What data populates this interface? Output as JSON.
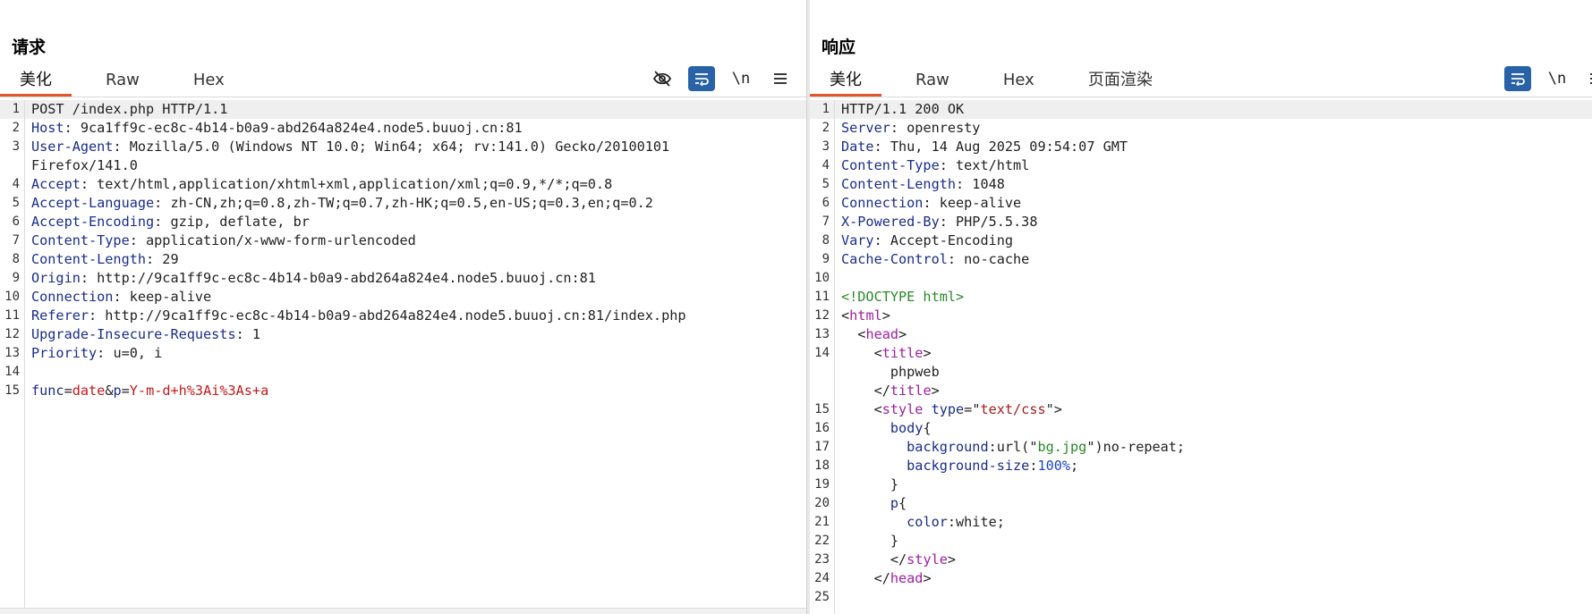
{
  "request": {
    "title": "请求",
    "tabs": [
      "美化",
      "Raw",
      "Hex"
    ],
    "active_tab": "美化",
    "toolbar": {
      "newline_label": "\\n"
    },
    "lines": [
      {
        "n": "1",
        "parts": [
          [
            "v",
            "POST /index.php HTTP/1.1"
          ]
        ]
      },
      {
        "n": "2",
        "parts": [
          [
            "k",
            "Host"
          ],
          [
            "v",
            ": 9ca1ff9c-ec8c-4b14-b0a9-abd264a824e4.node5.buuoj.cn:81"
          ]
        ]
      },
      {
        "n": "3",
        "parts": [
          [
            "k",
            "User-Agent"
          ],
          [
            "v",
            ": Mozilla/5.0 (Windows NT 10.0; Win64; x64; rv:141.0) Gecko/20100101"
          ]
        ]
      },
      {
        "n": "",
        "parts": [
          [
            "v",
            "Firefox/141.0"
          ]
        ]
      },
      {
        "n": "4",
        "parts": [
          [
            "k",
            "Accept"
          ],
          [
            "v",
            ": text/html,application/xhtml+xml,application/xml;q=0.9,*/*;q=0.8"
          ]
        ]
      },
      {
        "n": "5",
        "parts": [
          [
            "k",
            "Accept-Language"
          ],
          [
            "v",
            ": zh-CN,zh;q=0.8,zh-TW;q=0.7,zh-HK;q=0.5,en-US;q=0.3,en;q=0.2"
          ]
        ]
      },
      {
        "n": "6",
        "parts": [
          [
            "k",
            "Accept-Encoding"
          ],
          [
            "v",
            ": gzip, deflate, br"
          ]
        ]
      },
      {
        "n": "7",
        "parts": [
          [
            "k",
            "Content-Type"
          ],
          [
            "v",
            ": application/x-www-form-urlencoded"
          ]
        ]
      },
      {
        "n": "8",
        "parts": [
          [
            "k",
            "Content-Length"
          ],
          [
            "v",
            ": 29"
          ]
        ]
      },
      {
        "n": "9",
        "parts": [
          [
            "k",
            "Origin"
          ],
          [
            "v",
            ": http://9ca1ff9c-ec8c-4b14-b0a9-abd264a824e4.node5.buuoj.cn:81"
          ]
        ]
      },
      {
        "n": "10",
        "parts": [
          [
            "k",
            "Connection"
          ],
          [
            "v",
            ": keep-alive"
          ]
        ]
      },
      {
        "n": "11",
        "parts": [
          [
            "k",
            "Referer"
          ],
          [
            "v",
            ": http://9ca1ff9c-ec8c-4b14-b0a9-abd264a824e4.node5.buuoj.cn:81/index.php"
          ]
        ]
      },
      {
        "n": "12",
        "parts": [
          [
            "k",
            "Upgrade-Insecure-Requests"
          ],
          [
            "v",
            ": 1"
          ]
        ]
      },
      {
        "n": "13",
        "parts": [
          [
            "k",
            "Priority"
          ],
          [
            "v",
            ": u=0, i"
          ]
        ]
      },
      {
        "n": "14",
        "parts": [
          [
            "v",
            ""
          ]
        ]
      },
      {
        "n": "15",
        "parts": [
          [
            "pn",
            "func"
          ],
          [
            "v",
            "="
          ],
          [
            "pv",
            "date"
          ],
          [
            "v",
            "&"
          ],
          [
            "pn",
            "p"
          ],
          [
            "v",
            "="
          ],
          [
            "pv",
            "Y-m-d+h%3Ai%3As+a"
          ]
        ]
      }
    ]
  },
  "response": {
    "title": "响应",
    "tabs": [
      "美化",
      "Raw",
      "Hex",
      "页面渲染"
    ],
    "active_tab": "美化",
    "toolbar": {
      "newline_label": "\\n"
    },
    "lines": [
      {
        "n": "1",
        "parts": [
          [
            "v",
            "HTTP/1.1 200 OK"
          ]
        ]
      },
      {
        "n": "2",
        "parts": [
          [
            "k",
            "Server"
          ],
          [
            "v",
            ": openresty"
          ]
        ]
      },
      {
        "n": "3",
        "parts": [
          [
            "k",
            "Date"
          ],
          [
            "v",
            ": Thu, 14 Aug 2025 09:54:07 GMT"
          ]
        ]
      },
      {
        "n": "4",
        "parts": [
          [
            "k",
            "Content-Type"
          ],
          [
            "v",
            ": text/html"
          ]
        ]
      },
      {
        "n": "5",
        "parts": [
          [
            "k",
            "Content-Length"
          ],
          [
            "v",
            ": 1048"
          ]
        ]
      },
      {
        "n": "6",
        "parts": [
          [
            "k",
            "Connection"
          ],
          [
            "v",
            ": keep-alive"
          ]
        ]
      },
      {
        "n": "7",
        "parts": [
          [
            "k",
            "X-Powered-By"
          ],
          [
            "v",
            ": PHP/5.5.38"
          ]
        ]
      },
      {
        "n": "8",
        "parts": [
          [
            "k",
            "Vary"
          ],
          [
            "v",
            ": Accept-Encoding"
          ]
        ]
      },
      {
        "n": "9",
        "parts": [
          [
            "k",
            "Cache-Control"
          ],
          [
            "v",
            ": no-cache"
          ]
        ]
      },
      {
        "n": "10",
        "parts": [
          [
            "v",
            ""
          ]
        ]
      },
      {
        "n": "11",
        "parts": [
          [
            "doc",
            "<!DOCTYPE html>"
          ]
        ]
      },
      {
        "n": "12",
        "parts": [
          [
            "v",
            "<"
          ],
          [
            "tag",
            "html"
          ],
          [
            "v",
            ">"
          ]
        ]
      },
      {
        "n": "13",
        "parts": [
          [
            "v",
            "  <"
          ],
          [
            "tag",
            "head"
          ],
          [
            "v",
            ">"
          ]
        ]
      },
      {
        "n": "14",
        "parts": [
          [
            "v",
            "    <"
          ],
          [
            "tag",
            "title"
          ],
          [
            "v",
            ">"
          ]
        ]
      },
      {
        "n": "",
        "parts": [
          [
            "v",
            "      phpweb"
          ]
        ]
      },
      {
        "n": "",
        "parts": [
          [
            "v",
            "    </"
          ],
          [
            "tag",
            "title"
          ],
          [
            "v",
            ">"
          ]
        ]
      },
      {
        "n": "15",
        "parts": [
          [
            "v",
            "    <"
          ],
          [
            "tag",
            "style"
          ],
          [
            "v",
            " "
          ],
          [
            "k",
            "type"
          ],
          [
            "v",
            "=\""
          ],
          [
            "str",
            "text/css"
          ],
          [
            "v",
            "\">"
          ]
        ]
      },
      {
        "n": "16",
        "parts": [
          [
            "v",
            "      "
          ],
          [
            "k",
            "body"
          ],
          [
            "v",
            "{"
          ]
        ]
      },
      {
        "n": "17",
        "parts": [
          [
            "v",
            "        "
          ],
          [
            "k",
            "background"
          ],
          [
            "v",
            ":url("
          ],
          [
            "v",
            "\""
          ],
          [
            "doc",
            "bg.jpg"
          ],
          [
            "v",
            "\")no-repeat;"
          ]
        ]
      },
      {
        "n": "18",
        "parts": [
          [
            "v",
            "        "
          ],
          [
            "k",
            "background-size"
          ],
          [
            "v",
            ":"
          ],
          [
            "num-blue",
            "100%"
          ],
          [
            "v",
            ";"
          ]
        ]
      },
      {
        "n": "19",
        "parts": [
          [
            "v",
            "      }"
          ]
        ]
      },
      {
        "n": "20",
        "parts": [
          [
            "v",
            "      "
          ],
          [
            "k",
            "p"
          ],
          [
            "v",
            "{"
          ]
        ]
      },
      {
        "n": "21",
        "parts": [
          [
            "v",
            "        "
          ],
          [
            "k",
            "color"
          ],
          [
            "v",
            ":white;"
          ]
        ]
      },
      {
        "n": "22",
        "parts": [
          [
            "v",
            "      }"
          ]
        ]
      },
      {
        "n": "23",
        "parts": [
          [
            "v",
            "      </"
          ],
          [
            "tag",
            "style"
          ],
          [
            "v",
            ">"
          ]
        ]
      },
      {
        "n": "24",
        "parts": [
          [
            "v",
            "    </"
          ],
          [
            "tag",
            "head"
          ],
          [
            "v",
            ">"
          ]
        ]
      },
      {
        "n": "25",
        "parts": [
          [
            "v",
            ""
          ]
        ]
      }
    ]
  },
  "colors": {
    "accent_tab": "#e0562a",
    "toggle_on": "#2a62a8",
    "header_key": "#1a2e8a",
    "html_tag": "#a01fa0",
    "param_value": "#c41a1a"
  },
  "icons": [
    "eye-off-icon",
    "wrap-icon",
    "newline-icon",
    "menu-icon",
    "split-horizontal-icon",
    "split-vertical-icon",
    "single-pane-icon"
  ]
}
